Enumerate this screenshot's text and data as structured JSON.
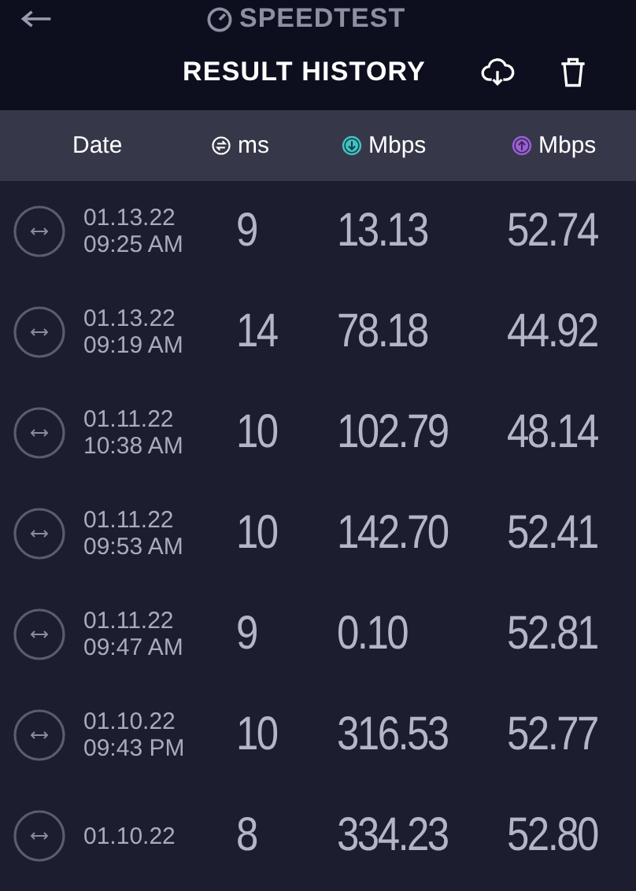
{
  "app": {
    "logo": "SPEEDTEST"
  },
  "header": {
    "title": "RESULT HISTORY"
  },
  "columns": [
    {
      "kind": "date",
      "label": "Date"
    },
    {
      "kind": "ping",
      "label": "ms"
    },
    {
      "kind": "download",
      "label": "Mbps"
    },
    {
      "kind": "upload",
      "label": "Mbps"
    }
  ],
  "rows": [
    {
      "date": "01.13.22",
      "time": "09:25 AM",
      "ping": "9",
      "download": "13.13",
      "upload": "52.74"
    },
    {
      "date": "01.13.22",
      "time": "09:19 AM",
      "ping": "14",
      "download": "78.18",
      "upload": "44.92"
    },
    {
      "date": "01.11.22",
      "time": "10:38 AM",
      "ping": "10",
      "download": "102.79",
      "upload": "48.14"
    },
    {
      "date": "01.11.22",
      "time": "09:53 AM",
      "ping": "10",
      "download": "142.70",
      "upload": "52.41"
    },
    {
      "date": "01.11.22",
      "time": "09:47 AM",
      "ping": "9",
      "download": "0.10",
      "upload": "52.81"
    },
    {
      "date": "01.10.22",
      "time": "09:43 PM",
      "ping": "10",
      "download": "316.53",
      "upload": "52.77"
    },
    {
      "date": "01.10.22",
      "ping": "8",
      "download": "334.23",
      "upload": "52.80"
    }
  ]
}
